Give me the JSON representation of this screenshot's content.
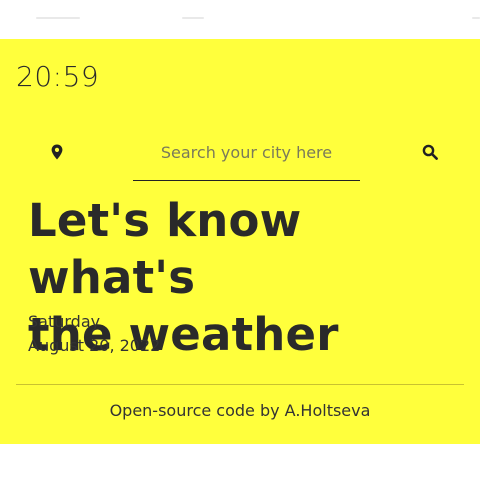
{
  "clock": {
    "time": "20:59"
  },
  "search": {
    "placeholder": "Search your city here",
    "value": ""
  },
  "icons": {
    "location": "location-pin-icon",
    "search": "search-icon"
  },
  "hero": {
    "line1": "Let's know what's",
    "line2": "the weather"
  },
  "date": {
    "weekday": "Saturday",
    "full": "August 20, 2022"
  },
  "footer": {
    "credit": "Open-source code by A.Holtseva"
  },
  "colors": {
    "background": "#ffff3c",
    "text": "#2a2a2a"
  }
}
